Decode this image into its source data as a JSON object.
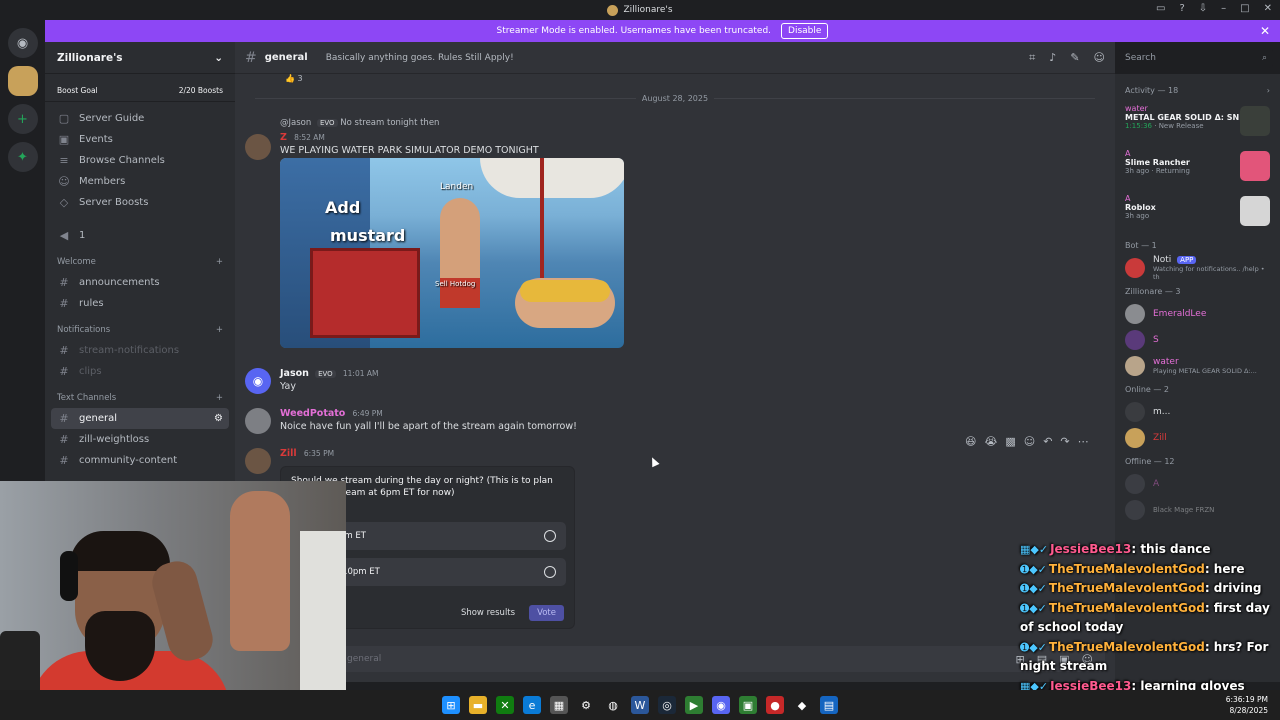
{
  "window": {
    "title": "Zillionare's"
  },
  "banner": {
    "text": "Streamer Mode is enabled. Usernames have been truncated.",
    "button": "Disable"
  },
  "server": {
    "name": "Zillionare's",
    "boost_goal": "Boost Goal",
    "boost_count": "2/20 Boosts"
  },
  "nav": [
    {
      "label": "Server Guide",
      "icon": "▢"
    },
    {
      "label": "Events",
      "icon": "▣"
    },
    {
      "label": "Browse Channels",
      "icon": "≡"
    },
    {
      "label": "Members",
      "icon": "☺"
    },
    {
      "label": "Server Boosts",
      "icon": "◇"
    }
  ],
  "voice_count": "1",
  "categories": {
    "welcome": "Welcome",
    "notifications": "Notifications",
    "text": "Text Channels"
  },
  "channels": {
    "announcements": "announcements",
    "rules": "rules",
    "stream_notifications": "stream-notifications",
    "clips": "clips",
    "general": "general",
    "weightloss": "zill-weightloss",
    "community": "community-content"
  },
  "header": {
    "channel": "general",
    "topic": "Basically anything goes. Rules Still Apply!"
  },
  "search": {
    "placeholder": "Search"
  },
  "chat": {
    "date": "August 28, 2025",
    "top_reaction": "3",
    "msg1": {
      "reply_to": "@Jason",
      "reply_badge": "EVO",
      "reply_text": "No stream tonight then",
      "author": "Z",
      "time": "8:52 AM",
      "text": "WE PLAYING WATER PARK SIMULATOR DEMO TONIGHT"
    },
    "image": {
      "caption1": "Add",
      "caption2": "mustard",
      "label": "Landen",
      "sell": "Sell Hotdog"
    },
    "msg2": {
      "author": "Jason",
      "badge": "EVO",
      "time": "11:01 AM",
      "text": "Yay"
    },
    "msg3": {
      "author": "WeedPotato",
      "time": "6:49 PM",
      "text": "Noice have fun yall I'll be apart of the stream again tomorrow!"
    },
    "msg4": {
      "author": "Zill",
      "time": "6:35 PM"
    },
    "poll": {
      "question": "Should we stream during the day or night? (This is to plan e, I'll still stream at 6pm ET for now)",
      "sub": "wer",
      "options": [
        "l 2pm - 8pm ET",
        "nd 6pm - 10pm ET"
      ],
      "left": "left",
      "show_results": "Show results",
      "vote": "Vote"
    },
    "composer_placeholder": "general"
  },
  "members": {
    "activity": "Activity — 18",
    "act1": {
      "user": "water",
      "game": "METAL GEAR SOLID Δ: SN...",
      "time": "1:15:36",
      "status": "New Release"
    },
    "act2": {
      "user": "A",
      "game": "Slime Rancher",
      "time": "3h ago",
      "status": "Returning"
    },
    "act3": {
      "user": "A",
      "game": "Roblox",
      "time": "3h ago"
    },
    "bot_cat": "Bot — 1",
    "bot": {
      "name": "Noti",
      "badge": "APP",
      "status": "Watching for notifications.. /help • th"
    },
    "role_cat": "Zillionare — 3",
    "m1": "EmeraldLee",
    "m2": "S",
    "m3": {
      "name": "water",
      "status": "Playing METAL GEAR SOLID Δ:..."
    },
    "online_cat": "Online — 2",
    "m4": "m...",
    "m5": "Zill",
    "offline_cat": "Offline — 12",
    "m6": "A",
    "m7": "Black Mage",
    "m8": "FRZN"
  },
  "overlay": [
    {
      "user": "JessieBee13",
      "msg": ": this dance",
      "gold": false
    },
    {
      "user": "TheTrueMalevolentGod",
      "msg": ": here",
      "gold": true
    },
    {
      "user": "TheTrueMalevolentGod",
      "msg": ": driving",
      "gold": true
    },
    {
      "user": "TheTrueMalevolentGod",
      "msg": ": first day of school today",
      "gold": true
    },
    {
      "user": "TheTrueMalevolentGod",
      "msg": ": hrs? For night stream",
      "gold": true
    },
    {
      "user": "JessieBee13",
      "msg": ": learning gloves",
      "gold": false
    }
  ],
  "clock": {
    "time": "6:36:19 PM",
    "date": "8/28/2025"
  }
}
